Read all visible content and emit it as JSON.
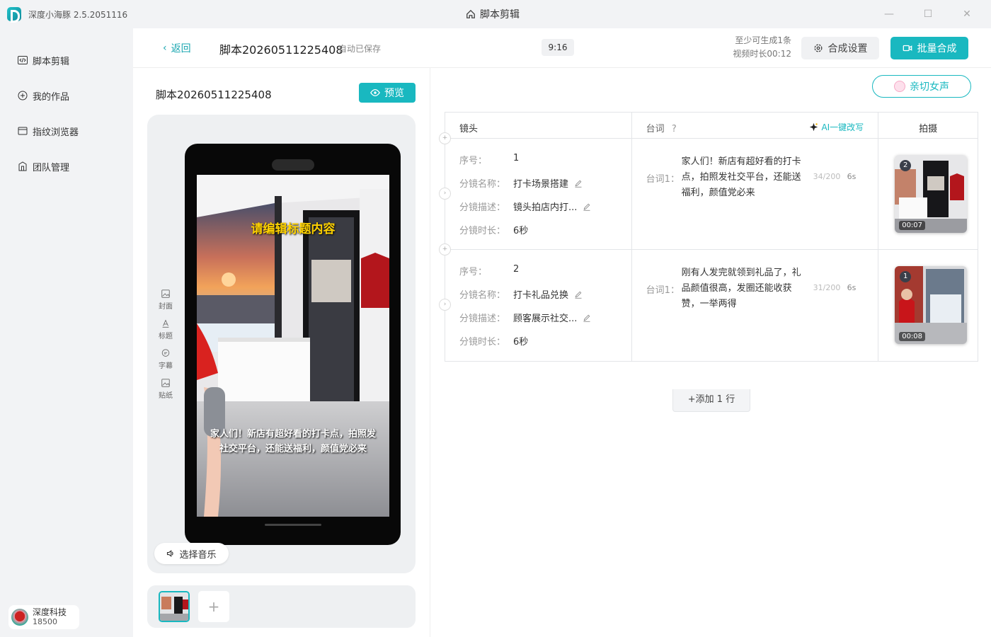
{
  "app": {
    "name": "深度小海豚 2.5.2051116",
    "window_title": "脚本剪辑"
  },
  "sidebar": {
    "items": [
      {
        "label": "脚本剪辑",
        "icon": "code-icon"
      },
      {
        "label": "我的作品",
        "icon": "gallery-icon"
      },
      {
        "label": "指纹浏览器",
        "icon": "browser-icon"
      },
      {
        "label": "团队管理",
        "icon": "team-icon"
      }
    ]
  },
  "user": {
    "name": "深度科技",
    "credits": "18500"
  },
  "topbar": {
    "back_label": "返回",
    "script_name": "脚本20260511225408",
    "autosave": "自动已保存",
    "ratio": "9:16",
    "min_gen": "至少可生成1条",
    "video_len": "视频时长00:12",
    "settings_label": "合成设置",
    "batch_label": "批量合成"
  },
  "left": {
    "title": "脚本20260511225408",
    "preview_label": "预览",
    "tools": [
      "封面",
      "标题",
      "字幕",
      "贴纸"
    ],
    "overlay_title": "请编辑标题内容",
    "overlay_subtitle": "家人们！新店有超好看的打卡点，拍照发社交平台，还能送福利，颜值党必来",
    "music_label": "选择音乐",
    "add_symbol": "+"
  },
  "right": {
    "voice_label": "亲切女声",
    "headers": {
      "shot": "镜头",
      "line": "台词",
      "line_help": "?",
      "ai": "AI一键改写",
      "capture": "拍摄"
    },
    "field_labels": {
      "seq": "序号：",
      "name": "分镜名称：",
      "desc": "分镜描述：",
      "dur": "分镜时长："
    },
    "rows": [
      {
        "seq": "1",
        "name": "打卡场景搭建",
        "desc": "镜头拍店内打...",
        "dur": "6秒",
        "line_label": "台词1：",
        "line": "家人们！新店有超好看的打卡点，拍照发社交平台，还能送福利，颜值党必来",
        "count": "34/200",
        "line_dur": "6s",
        "badge": "2",
        "time": "00:07"
      },
      {
        "seq": "2",
        "name": "打卡礼品兑换",
        "desc": "顾客展示社交...",
        "dur": "6秒",
        "line_label": "台词1：",
        "line": "刚有人发完就领到礼品了，礼品颜值很高，发圈还能收获赞，一举两得",
        "count": "31/200",
        "line_dur": "6s",
        "badge": "1",
        "time": "00:08"
      }
    ],
    "add_row_label": "+添加 1 行"
  },
  "colors": {
    "accent": "#19b8c0",
    "overlay_title": "#ffd200"
  }
}
